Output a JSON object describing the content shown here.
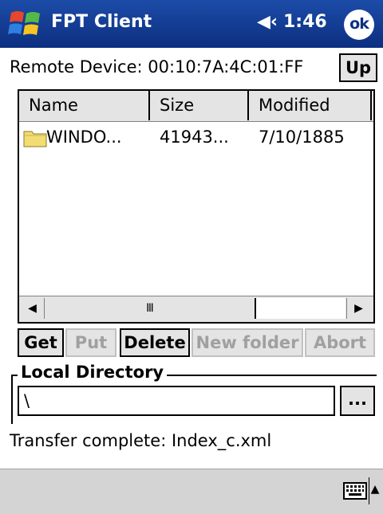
{
  "titlebar": {
    "app_title": "FPT Client",
    "speaker_glyph": "◀‹",
    "clock": "1:46",
    "ok_label": "ok",
    "icons": {
      "start": "windows-flag-icon",
      "volume": "speaker-icon"
    }
  },
  "remote": {
    "label": "Remote Device: 00:10:7A:4C:01:FF",
    "up_label": "Up"
  },
  "file_list": {
    "columns": [
      "Name",
      "Size",
      "Modified"
    ],
    "rows": [
      {
        "name": "WINDO...",
        "size": "41943...",
        "modified": "7/10/1885",
        "icon": "folder-icon"
      }
    ],
    "scrollbar": {
      "left_arrow": "◀",
      "thumb_grip": "Ⅲ",
      "right_arrow": "▶"
    }
  },
  "actions": {
    "get": "Get",
    "put": "Put",
    "delete": "Delete",
    "new_folder": "New folder",
    "abort": "Abort"
  },
  "local_directory": {
    "label": "Local Directory",
    "value": "\\",
    "browse_label": "..."
  },
  "status": "Transfer complete: Index_c.xml",
  "bottombar": {
    "input_icon": "keyboard-icon",
    "arrow": "▲"
  },
  "colors": {
    "titlebar": "#0c2f80",
    "button_face": "#e4e4e4",
    "disabled_text": "#a0a0a0",
    "folder": "#f2dd74"
  }
}
